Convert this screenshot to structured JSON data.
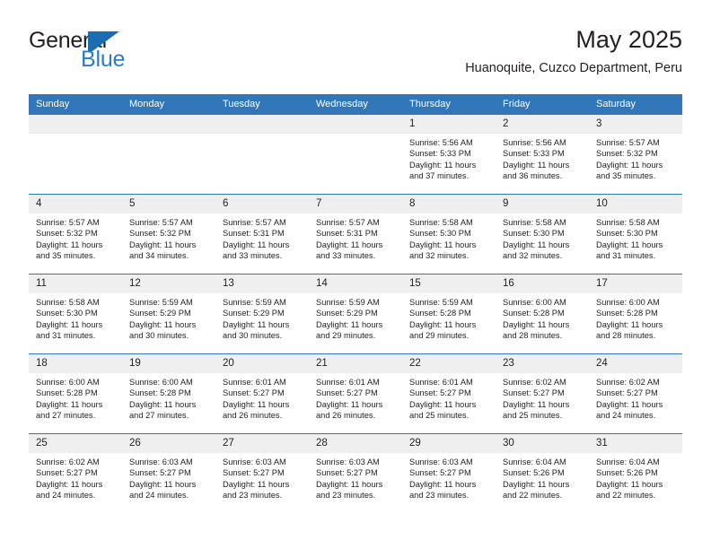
{
  "brand": {
    "name_part1": "General",
    "name_part2": "Blue"
  },
  "header": {
    "title": "May 2025",
    "location": "Huanoquite, Cuzco Department, Peru"
  },
  "colors": {
    "header_blue": "#3176b8",
    "daynum_gray": "#efeff0",
    "brand_blue": "#2b7cc0",
    "text": "#231f20"
  },
  "weekdays": [
    "Sunday",
    "Monday",
    "Tuesday",
    "Wednesday",
    "Thursday",
    "Friday",
    "Saturday"
  ],
  "weeks": [
    [
      {
        "day": "",
        "sunrise": "",
        "sunset": "",
        "daylight": "",
        "empty": true
      },
      {
        "day": "",
        "sunrise": "",
        "sunset": "",
        "daylight": "",
        "empty": true
      },
      {
        "day": "",
        "sunrise": "",
        "sunset": "",
        "daylight": "",
        "empty": true
      },
      {
        "day": "",
        "sunrise": "",
        "sunset": "",
        "daylight": "",
        "empty": true
      },
      {
        "day": "1",
        "sunrise": "Sunrise: 5:56 AM",
        "sunset": "Sunset: 5:33 PM",
        "daylight": "Daylight: 11 hours and 37 minutes.",
        "empty": false
      },
      {
        "day": "2",
        "sunrise": "Sunrise: 5:56 AM",
        "sunset": "Sunset: 5:33 PM",
        "daylight": "Daylight: 11 hours and 36 minutes.",
        "empty": false
      },
      {
        "day": "3",
        "sunrise": "Sunrise: 5:57 AM",
        "sunset": "Sunset: 5:32 PM",
        "daylight": "Daylight: 11 hours and 35 minutes.",
        "empty": false
      }
    ],
    [
      {
        "day": "4",
        "sunrise": "Sunrise: 5:57 AM",
        "sunset": "Sunset: 5:32 PM",
        "daylight": "Daylight: 11 hours and 35 minutes.",
        "empty": false
      },
      {
        "day": "5",
        "sunrise": "Sunrise: 5:57 AM",
        "sunset": "Sunset: 5:32 PM",
        "daylight": "Daylight: 11 hours and 34 minutes.",
        "empty": false
      },
      {
        "day": "6",
        "sunrise": "Sunrise: 5:57 AM",
        "sunset": "Sunset: 5:31 PM",
        "daylight": "Daylight: 11 hours and 33 minutes.",
        "empty": false
      },
      {
        "day": "7",
        "sunrise": "Sunrise: 5:57 AM",
        "sunset": "Sunset: 5:31 PM",
        "daylight": "Daylight: 11 hours and 33 minutes.",
        "empty": false
      },
      {
        "day": "8",
        "sunrise": "Sunrise: 5:58 AM",
        "sunset": "Sunset: 5:30 PM",
        "daylight": "Daylight: 11 hours and 32 minutes.",
        "empty": false
      },
      {
        "day": "9",
        "sunrise": "Sunrise: 5:58 AM",
        "sunset": "Sunset: 5:30 PM",
        "daylight": "Daylight: 11 hours and 32 minutes.",
        "empty": false
      },
      {
        "day": "10",
        "sunrise": "Sunrise: 5:58 AM",
        "sunset": "Sunset: 5:30 PM",
        "daylight": "Daylight: 11 hours and 31 minutes.",
        "empty": false
      }
    ],
    [
      {
        "day": "11",
        "sunrise": "Sunrise: 5:58 AM",
        "sunset": "Sunset: 5:30 PM",
        "daylight": "Daylight: 11 hours and 31 minutes.",
        "empty": false
      },
      {
        "day": "12",
        "sunrise": "Sunrise: 5:59 AM",
        "sunset": "Sunset: 5:29 PM",
        "daylight": "Daylight: 11 hours and 30 minutes.",
        "empty": false
      },
      {
        "day": "13",
        "sunrise": "Sunrise: 5:59 AM",
        "sunset": "Sunset: 5:29 PM",
        "daylight": "Daylight: 11 hours and 30 minutes.",
        "empty": false
      },
      {
        "day": "14",
        "sunrise": "Sunrise: 5:59 AM",
        "sunset": "Sunset: 5:29 PM",
        "daylight": "Daylight: 11 hours and 29 minutes.",
        "empty": false
      },
      {
        "day": "15",
        "sunrise": "Sunrise: 5:59 AM",
        "sunset": "Sunset: 5:28 PM",
        "daylight": "Daylight: 11 hours and 29 minutes.",
        "empty": false
      },
      {
        "day": "16",
        "sunrise": "Sunrise: 6:00 AM",
        "sunset": "Sunset: 5:28 PM",
        "daylight": "Daylight: 11 hours and 28 minutes.",
        "empty": false
      },
      {
        "day": "17",
        "sunrise": "Sunrise: 6:00 AM",
        "sunset": "Sunset: 5:28 PM",
        "daylight": "Daylight: 11 hours and 28 minutes.",
        "empty": false
      }
    ],
    [
      {
        "day": "18",
        "sunrise": "Sunrise: 6:00 AM",
        "sunset": "Sunset: 5:28 PM",
        "daylight": "Daylight: 11 hours and 27 minutes.",
        "empty": false
      },
      {
        "day": "19",
        "sunrise": "Sunrise: 6:00 AM",
        "sunset": "Sunset: 5:28 PM",
        "daylight": "Daylight: 11 hours and 27 minutes.",
        "empty": false
      },
      {
        "day": "20",
        "sunrise": "Sunrise: 6:01 AM",
        "sunset": "Sunset: 5:27 PM",
        "daylight": "Daylight: 11 hours and 26 minutes.",
        "empty": false
      },
      {
        "day": "21",
        "sunrise": "Sunrise: 6:01 AM",
        "sunset": "Sunset: 5:27 PM",
        "daylight": "Daylight: 11 hours and 26 minutes.",
        "empty": false
      },
      {
        "day": "22",
        "sunrise": "Sunrise: 6:01 AM",
        "sunset": "Sunset: 5:27 PM",
        "daylight": "Daylight: 11 hours and 25 minutes.",
        "empty": false
      },
      {
        "day": "23",
        "sunrise": "Sunrise: 6:02 AM",
        "sunset": "Sunset: 5:27 PM",
        "daylight": "Daylight: 11 hours and 25 minutes.",
        "empty": false
      },
      {
        "day": "24",
        "sunrise": "Sunrise: 6:02 AM",
        "sunset": "Sunset: 5:27 PM",
        "daylight": "Daylight: 11 hours and 24 minutes.",
        "empty": false
      }
    ],
    [
      {
        "day": "25",
        "sunrise": "Sunrise: 6:02 AM",
        "sunset": "Sunset: 5:27 PM",
        "daylight": "Daylight: 11 hours and 24 minutes.",
        "empty": false
      },
      {
        "day": "26",
        "sunrise": "Sunrise: 6:03 AM",
        "sunset": "Sunset: 5:27 PM",
        "daylight": "Daylight: 11 hours and 24 minutes.",
        "empty": false
      },
      {
        "day": "27",
        "sunrise": "Sunrise: 6:03 AM",
        "sunset": "Sunset: 5:27 PM",
        "daylight": "Daylight: 11 hours and 23 minutes.",
        "empty": false
      },
      {
        "day": "28",
        "sunrise": "Sunrise: 6:03 AM",
        "sunset": "Sunset: 5:27 PM",
        "daylight": "Daylight: 11 hours and 23 minutes.",
        "empty": false
      },
      {
        "day": "29",
        "sunrise": "Sunrise: 6:03 AM",
        "sunset": "Sunset: 5:27 PM",
        "daylight": "Daylight: 11 hours and 23 minutes.",
        "empty": false
      },
      {
        "day": "30",
        "sunrise": "Sunrise: 6:04 AM",
        "sunset": "Sunset: 5:26 PM",
        "daylight": "Daylight: 11 hours and 22 minutes.",
        "empty": false
      },
      {
        "day": "31",
        "sunrise": "Sunrise: 6:04 AM",
        "sunset": "Sunset: 5:26 PM",
        "daylight": "Daylight: 11 hours and 22 minutes.",
        "empty": false
      }
    ]
  ]
}
